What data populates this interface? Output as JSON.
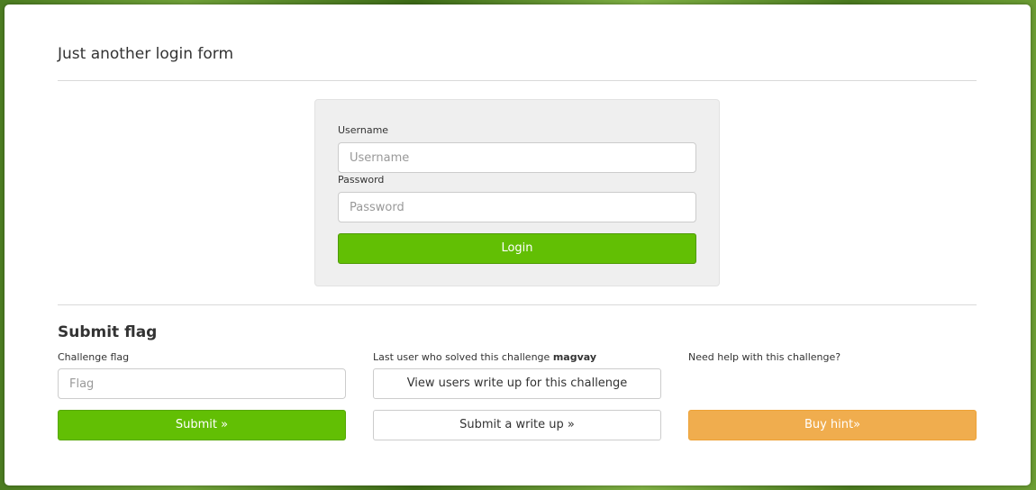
{
  "page_title": "Just another login form",
  "login": {
    "username_label": "Username",
    "username_placeholder": "Username",
    "password_label": "Password",
    "password_placeholder": "Password",
    "login_button": "Login"
  },
  "flag_section": {
    "title": "Submit flag",
    "challenge_flag_label": "Challenge flag",
    "flag_placeholder": "Flag",
    "submit_button": "Submit »",
    "last_solver_prefix": "Last user who solved this challenge",
    "last_solver_name": "magvay",
    "view_writeups_button": "View users write up for this challenge",
    "submit_writeup_button": "Submit a write up »",
    "help_label": "Need help with this challenge?",
    "buy_hint_button": "Buy hint»"
  },
  "colors": {
    "primary_green": "#62bf04",
    "hint_orange": "#f0ad4e"
  }
}
